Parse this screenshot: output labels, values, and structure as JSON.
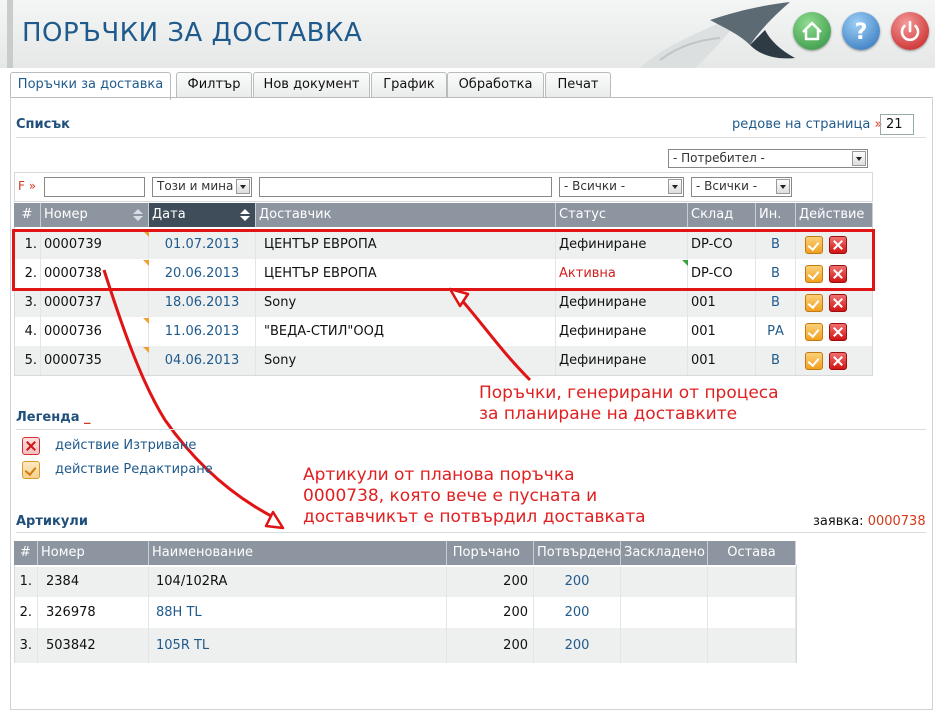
{
  "header": {
    "title": "ПОРЪЧКИ ЗА ДОСТАВКА",
    "buttons": [
      {
        "name": "home-button",
        "icon": "home-icon",
        "color": "#3a9a4a"
      },
      {
        "name": "help-button",
        "icon": "question-icon",
        "glyph": "?",
        "color": "#2f7fc4"
      },
      {
        "name": "power-button",
        "icon": "power-icon",
        "color": "#d22828"
      }
    ]
  },
  "tabs": [
    {
      "label": "Поръчки за доставка",
      "active": true
    },
    {
      "label": "Филтър",
      "active": false
    },
    {
      "label": "Нов документ",
      "active": false
    },
    {
      "label": "График",
      "active": false
    },
    {
      "label": "Обработка",
      "active": false
    },
    {
      "label": "Печат",
      "active": false
    }
  ],
  "list": {
    "title": "Списък",
    "rows_per_page_label": "редове на страница",
    "rows_per_page_arrow": "»",
    "rows_per_page": "21",
    "user_filter": "- Потребител -",
    "filter_label": "F »",
    "filters": {
      "date": "Този и мина",
      "status": "- Всички -",
      "warehouse": "- Всички -"
    },
    "columns": [
      "#",
      "Номер",
      "Дата",
      "Доставчик",
      "Статус",
      "Склад",
      "Ин.",
      "Действие"
    ],
    "rows": [
      {
        "n": "1.",
        "number": "0000739",
        "date": "01.07.2013",
        "supplier": "ЦЕНТЪР ЕВРОПА",
        "status": "Дефиниране",
        "status_active": false,
        "warehouse": "DP-CO",
        "in": "В"
      },
      {
        "n": "2.",
        "number": "0000738",
        "date": "20.06.2013",
        "supplier": "ЦЕНТЪР ЕВРОПА",
        "status": "Активна",
        "status_active": true,
        "warehouse": "DP-CO",
        "in": "В"
      },
      {
        "n": "3.",
        "number": "0000737",
        "date": "18.06.2013",
        "supplier": "Sony",
        "status": "Дефиниране",
        "status_active": false,
        "warehouse": "001",
        "in": "В"
      },
      {
        "n": "4.",
        "number": "0000736",
        "date": "11.06.2013",
        "supplier": "\"ВЕДА-СТИЛ\"ООД",
        "status": "Дефиниране",
        "status_active": false,
        "warehouse": "001",
        "in": "РА"
      },
      {
        "n": "5.",
        "number": "0000735",
        "date": "04.06.2013",
        "supplier": "Sony",
        "status": "Дефиниране",
        "status_active": false,
        "warehouse": "001",
        "in": "В"
      }
    ]
  },
  "annotations": {
    "orders_note_1": "Поръчки, генерирани от процеса",
    "orders_note_2": "за планиране на доставките",
    "articles_note_1": "Артикули от планова поръчка",
    "articles_note_2": "0000738, която вече е пусната и",
    "articles_note_3": "доставчикът е потвърдил доставката"
  },
  "legend": {
    "title": "Легенда",
    "title_suffix": "_",
    "delete": "действие Изтриване",
    "edit": "действие Редактиране"
  },
  "articles": {
    "title": "Артикули",
    "request_label": "заявка:",
    "request_value": "0000738",
    "columns": [
      "#",
      "Номер",
      "Наименование",
      "Поръчано",
      "Потвърдено",
      "Заскладено",
      "Остава"
    ],
    "rows": [
      {
        "n": "1.",
        "number": "2384",
        "name": "104/102RA",
        "name_link": false,
        "ordered": "200",
        "confirmed": "200"
      },
      {
        "n": "2.",
        "number": "326978",
        "name": "88H TL",
        "name_link": true,
        "ordered": "200",
        "confirmed": "200"
      },
      {
        "n": "3.",
        "number": "503842",
        "name": "105R TL",
        "name_link": true,
        "ordered": "200",
        "confirmed": "200"
      }
    ]
  }
}
